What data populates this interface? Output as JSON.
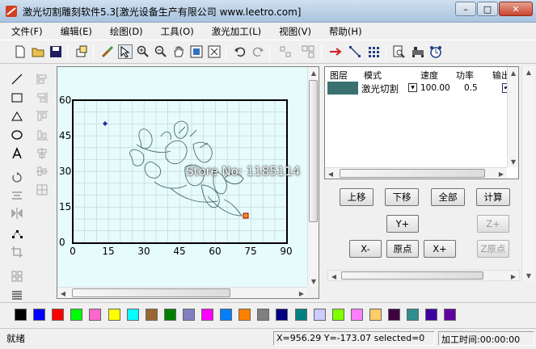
{
  "window": {
    "title": "激光切割雕刻软件5.3[激光设备生产有限公司 www.leetro.com]",
    "icons": {
      "app": "laser-app-icon",
      "minimize": "minimize-icon",
      "maximize": "maximize-icon",
      "close": "close-icon"
    }
  },
  "menu": [
    "文件(F)",
    "编辑(E)",
    "绘图(D)",
    "工具(O)",
    "激光加工(L)",
    "视图(V)",
    "帮助(H)"
  ],
  "toolbar": {
    "icons": [
      "new-file-icon",
      "open-folder-icon",
      "save-icon",
      "import-icon",
      "brush-icon",
      "select-arrow-icon",
      "zoom-in-icon",
      "zoom-out-icon",
      "pan-hand-icon",
      "fit-page-icon",
      "zoom-extent-icon",
      "undo-icon",
      "redo-icon",
      "group-icon",
      "ungroup-icon",
      "laser-path-icon",
      "node-edit-icon",
      "array-icon",
      "preview-icon",
      "machine-icon",
      "clock-icon"
    ]
  },
  "left_tools": {
    "icons": [
      "line-icon",
      "rectangle-icon",
      "polygon-icon",
      "ellipse-icon",
      "text-icon",
      "rotate-icon",
      "align-icon",
      "mirror-icon",
      "node-icon",
      "crop-icon",
      "grid-icon",
      "layers-icon"
    ]
  },
  "canvas": {
    "background": "#e6fcfc",
    "x_ticks": [
      "0",
      "15",
      "30",
      "45",
      "60",
      "75",
      "90"
    ],
    "y_ticks": [
      "60",
      "45",
      "30",
      "15",
      "0"
    ]
  },
  "layer_table": {
    "headers": [
      "图层",
      "模式",
      "速度",
      "功率",
      "输出"
    ],
    "rows": [
      {
        "color": "#3b7070",
        "mode": "激光切割",
        "speed": "100.00",
        "power": "0.5",
        "output": "✔"
      }
    ]
  },
  "buttons": {
    "move_up": "上移",
    "move_down": "下移",
    "all": "全部",
    "calc": "计算",
    "y_plus": "Y+",
    "z_plus": "Z+",
    "x_minus": "X-",
    "origin": "原点",
    "x_plus": "X+",
    "z_origin": "Z原点"
  },
  "overlay_text": "Store No: 1185114",
  "palette": [
    "#000000",
    "#0000ff",
    "#ff0000",
    "#00ff00",
    "#ff66cc",
    "#ffff00",
    "#00ffff",
    "#996633",
    "#008000",
    "#8080c0",
    "#ff00ff",
    "#0080ff",
    "#ff8000",
    "#808080",
    "#000080",
    "#008080",
    "#ccccff",
    "#80ff00",
    "#ff80ff",
    "#ffcc66",
    "#400040",
    "#2f8f8f",
    "#4000a0",
    "#6000a0"
  ],
  "status": {
    "ready": "就绪",
    "coords": "X=956.29 Y=-173.07 selected=0",
    "time": "加工时间:00:00:00"
  }
}
